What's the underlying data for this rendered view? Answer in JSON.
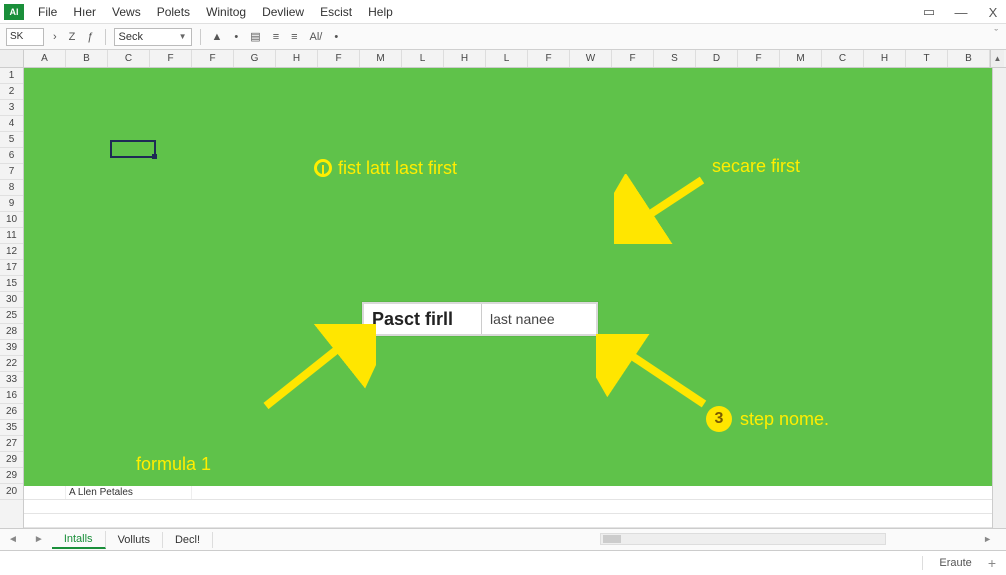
{
  "app": {
    "icon_label": "Al"
  },
  "menus": [
    "File",
    "Hıer",
    "Vews",
    "Polets",
    "Winitog",
    "Devliew",
    "Escist",
    "Help"
  ],
  "window_controls": {
    "min": "▭",
    "dash": "—",
    "close": "X"
  },
  "toolbar": {
    "namebox": "SK",
    "btn_left1": "›",
    "btn_left2": "Z",
    "btn_fx": "ƒ",
    "font_name": "Seck",
    "icons": [
      "▲",
      "•",
      "▤",
      "≡",
      "≡",
      "Al/",
      "•"
    ],
    "right_caret": "ˇ"
  },
  "columns": [
    "A",
    "B",
    "C",
    "F",
    "F",
    "G",
    "H",
    "F",
    "M",
    "L",
    "H",
    "L",
    "F",
    "W",
    "F",
    "S",
    "D",
    "F",
    "M",
    "C",
    "H",
    "T",
    "B"
  ],
  "rows_left": [
    "1",
    "2",
    "3",
    "4",
    "5",
    "6",
    "7",
    "8",
    "9",
    "10",
    "11",
    "12",
    "17",
    "15",
    "30",
    "25",
    "28",
    "39",
    "22",
    "33",
    "16",
    "26",
    "35",
    "27",
    "29",
    "29",
    "20"
  ],
  "overlay": {
    "line1": "fist latt last first",
    "line2": "secare first",
    "formula": "formula 1",
    "step_badge": "3",
    "step_text": "step nome.",
    "center_left": "Pasct firll",
    "center_right": "last nanee"
  },
  "plain_cell_text": "A Llen Petales",
  "sheet_tabs": {
    "active": "Intalls",
    "others": [
      "Volluts",
      "Decl!"
    ]
  },
  "status": {
    "mode": "Eraute",
    "plus": "+"
  }
}
